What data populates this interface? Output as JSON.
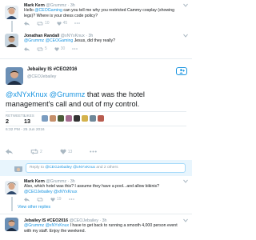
{
  "tweets": [
    {
      "name": "Mark Kern",
      "handle": "@Grummz",
      "time": "3h",
      "text_parts": [
        {
          "t": "Hello ",
          "link": false
        },
        {
          "t": "@CEOGaming",
          "link": true
        },
        {
          "t": " can you tell me why you restricted Cammy cosplay (showing legs)? Where is your dress code policy?",
          "link": false
        }
      ],
      "replies": "",
      "retweets": "10",
      "likes": "45"
    },
    {
      "name": "Jonathan Randall",
      "handle": "@xNYxKnux",
      "time": "3h",
      "text_parts": [
        {
          "t": "@Grummz ",
          "link": true
        },
        {
          "t": "@CEOGaming",
          "link": true
        },
        {
          "t": " Jesus, did they really?",
          "link": false
        }
      ],
      "replies": "",
      "retweets": "5",
      "likes": "30"
    }
  ],
  "focus": {
    "name": "Jebailey IS #CEO2016",
    "handle": "@CEOJebailey",
    "text_link": "@xNYxKnux @Grummz",
    "text_rest": " that was the hotel management's call and out of my control.",
    "retweets_label": "RETWEETS",
    "retweets": "2",
    "likes_label": "LIKES",
    "likes": "13",
    "timestamp": "6:32 PM - 25 Jun 2016",
    "action_retweets": "2",
    "action_likes": "13"
  },
  "reply_box": {
    "prefix": "Reply to ",
    "mention1": "@CEGJebailey",
    "mention2": "@xNYxKnux",
    "rest": " and 2 others"
  },
  "replies": [
    {
      "name": "Mark Kern",
      "handle": "@Grummz",
      "time": "3h",
      "text_plain": "Also, which hotel was this? I assume they have a pool...and allow bikinis?",
      "text_link": "@CEOJebailey @xNYxKnux",
      "retweets": "",
      "likes": "19",
      "view_other": "View other replies"
    },
    {
      "name": "Jebailey IS #CEO2016",
      "handle": "@CEOJebailey",
      "time": "3h",
      "text_link1": "@Grummz",
      "text_link2": "@xNYxKnux",
      "text_rest": " I have to get back to running a smooth 4,000 person event with my staff. Enjoy the weekend."
    }
  ],
  "colors": {
    "link": "#1b95e0",
    "muted": "#8899a6",
    "divider": "#e6ecf0"
  }
}
